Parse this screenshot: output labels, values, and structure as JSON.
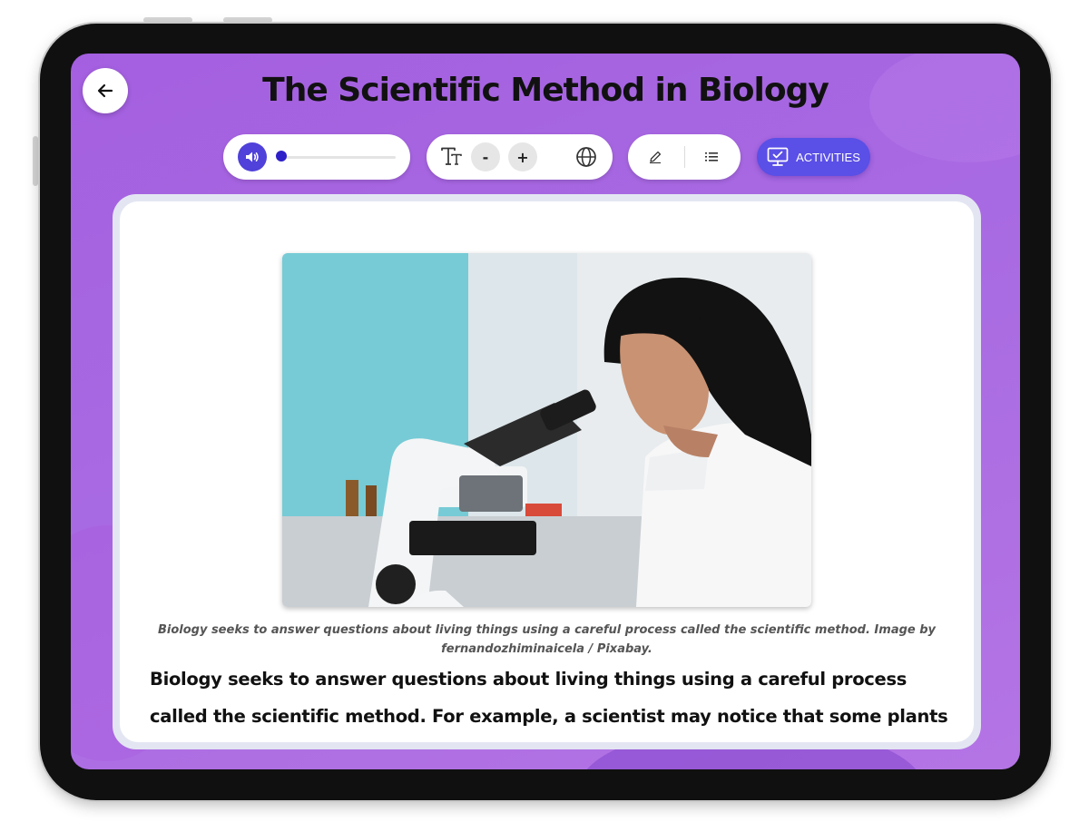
{
  "page": {
    "title": "The Scientific Method in Biology"
  },
  "toolbar": {
    "audio": {
      "volume_level": 0.0
    },
    "activities_label": "ACTIVITIES"
  },
  "content": {
    "image_caption": "Biology seeks to answer questions about living things using a careful process called the scientific method. Image by fernandozhiminaicela / Pixabay.",
    "body_text": "Biology seeks to answer questions about living things using a careful process called the scientific method. For example, a scientist may notice that some plants"
  },
  "colors": {
    "screen_background": "#a962e1",
    "accent_blue": "#4f41d9",
    "activities_button": "#5a4fe6"
  },
  "icons": {
    "back": "arrow-left-icon",
    "volume": "speaker-icon",
    "text_size": "text-format-icon",
    "decrease": "minus-icon",
    "increase": "plus-icon",
    "language": "globe-icon",
    "highlight": "pencil-icon",
    "outline": "list-icon",
    "activities": "monitor-check-icon"
  }
}
